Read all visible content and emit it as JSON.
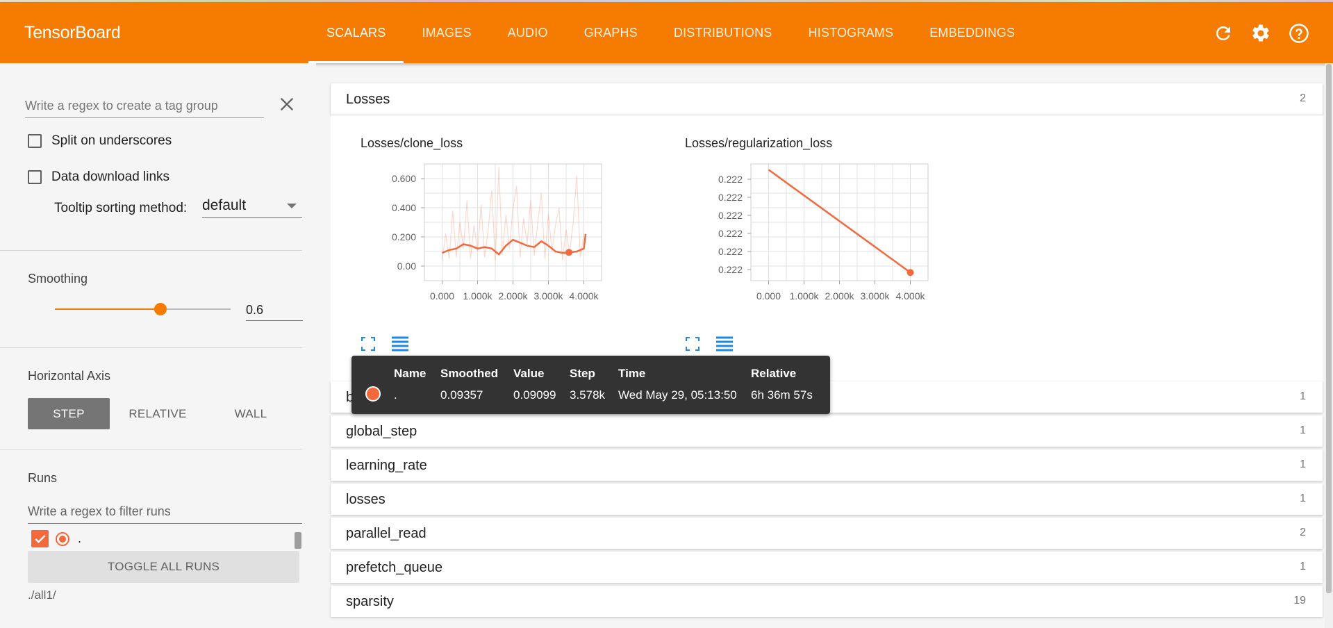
{
  "app": {
    "title": "TensorBoard",
    "accent_color": "#f57c00",
    "run_color": "#f4693c"
  },
  "nav": {
    "tabs": [
      {
        "label": "SCALARS",
        "active": true
      },
      {
        "label": "IMAGES",
        "active": false
      },
      {
        "label": "AUDIO",
        "active": false
      },
      {
        "label": "GRAPHS",
        "active": false
      },
      {
        "label": "DISTRIBUTIONS",
        "active": false
      },
      {
        "label": "HISTOGRAMS",
        "active": false
      },
      {
        "label": "EMBEDDINGS",
        "active": false
      }
    ],
    "icons": [
      "refresh-icon",
      "settings-icon",
      "help-icon"
    ]
  },
  "sidebar": {
    "tag_regex_placeholder": "Write a regex to create a tag group",
    "split_underscores_label": "Split on underscores",
    "split_underscores_checked": false,
    "data_download_label": "Data download links",
    "data_download_checked": false,
    "tooltip_sort_label": "Tooltip sorting method:",
    "tooltip_sort_value": "default",
    "smoothing_label": "Smoothing",
    "smoothing_value": "0.6",
    "smoothing_fraction": 0.6,
    "horizontal_axis_label": "Horizontal Axis",
    "axis_options": [
      "STEP",
      "RELATIVE",
      "WALL"
    ],
    "axis_selected": "STEP",
    "runs_label": "Runs",
    "runs_filter_placeholder": "Write a regex to filter runs",
    "runs": [
      {
        "name": ".",
        "checked": true
      }
    ],
    "toggle_all_label": "TOGGLE ALL RUNS",
    "logdir": "./all1/"
  },
  "main": {
    "expanded_group": {
      "title": "Losses",
      "count": "2"
    },
    "groups": [
      {
        "title": "batch",
        "count": "1"
      },
      {
        "title": "global_step",
        "count": "1"
      },
      {
        "title": "learning_rate",
        "count": "1"
      },
      {
        "title": "losses",
        "count": "1"
      },
      {
        "title": "parallel_read",
        "count": "2"
      },
      {
        "title": "prefetch_queue",
        "count": "1"
      },
      {
        "title": "sparsity",
        "count": "19"
      }
    ]
  },
  "chart_data": [
    {
      "type": "line",
      "title": "Losses/clone_loss",
      "x_tick_labels": [
        "0.000",
        "1.000k",
        "2.000k",
        "3.000k",
        "4.000k"
      ],
      "y_tick_labels": [
        "0.600",
        "0.400",
        "0.200",
        "0.00"
      ],
      "xlim": [
        -500,
        4500
      ],
      "ylim": [
        -0.1,
        0.7
      ],
      "grid": true,
      "series": [
        {
          "role": "smoothed",
          "x": [
            0,
            200,
            400,
            600,
            800,
            1000,
            1200,
            1400,
            1600,
            1800,
            2000,
            2200,
            2400,
            2600,
            2800,
            3000,
            3200,
            3400,
            3600,
            3800,
            4000,
            4050
          ],
          "y": [
            0.09,
            0.11,
            0.12,
            0.15,
            0.14,
            0.12,
            0.13,
            0.12,
            0.08,
            0.14,
            0.18,
            0.16,
            0.14,
            0.13,
            0.17,
            0.14,
            0.1,
            0.09,
            0.094,
            0.1,
            0.12,
            0.22
          ]
        },
        {
          "role": "raw",
          "x": [
            0,
            100,
            200,
            300,
            400,
            500,
            600,
            700,
            800,
            900,
            1000,
            1100,
            1200,
            1300,
            1400,
            1500,
            1600,
            1700,
            1800,
            1900,
            2000,
            2100,
            2200,
            2300,
            2400,
            2500,
            2600,
            2700,
            2800,
            2900,
            3000,
            3100,
            3200,
            3300,
            3400,
            3500,
            3600,
            3700,
            3800,
            3900,
            4000
          ],
          "y": [
            0.04,
            0.22,
            0.05,
            0.38,
            0.06,
            0.3,
            0.12,
            0.45,
            0.05,
            0.28,
            0.1,
            0.42,
            0.06,
            0.25,
            0.52,
            0.04,
            0.68,
            0.08,
            0.35,
            0.12,
            0.4,
            0.55,
            0.06,
            0.33,
            0.15,
            0.45,
            0.07,
            0.3,
            0.5,
            0.05,
            0.36,
            0.1,
            0.28,
            0.4,
            0.04,
            0.25,
            0.09,
            0.3,
            0.62,
            0.06,
            0.22
          ]
        }
      ],
      "marker": {
        "x": 3578,
        "y": 0.09357
      }
    },
    {
      "type": "line",
      "title": "Losses/regularization_loss",
      "x_tick_labels": [
        "0.000",
        "1.000k",
        "2.000k",
        "3.000k",
        "4.000k"
      ],
      "y_tick_labels": [
        "0.222",
        "0.222",
        "0.222",
        "0.222",
        "0.222",
        "0.222"
      ],
      "xlim": [
        -500,
        4500
      ],
      "ylim": [
        0,
        1
      ],
      "grid": true,
      "series": [
        {
          "role": "smoothed",
          "x": [
            0,
            4000
          ],
          "y": [
            0.95,
            0.07
          ]
        }
      ],
      "marker": {
        "x": 4000,
        "y": 0.07
      }
    }
  ],
  "tooltip": {
    "headers": [
      "Name",
      "Smoothed",
      "Value",
      "Step",
      "Time",
      "Relative"
    ],
    "row": {
      "name": ".",
      "smoothed": "0.09357",
      "value": "0.09099",
      "step": "3.578k",
      "time": "Wed May 29, 05:13:50",
      "relative": "6h 36m 57s"
    }
  }
}
